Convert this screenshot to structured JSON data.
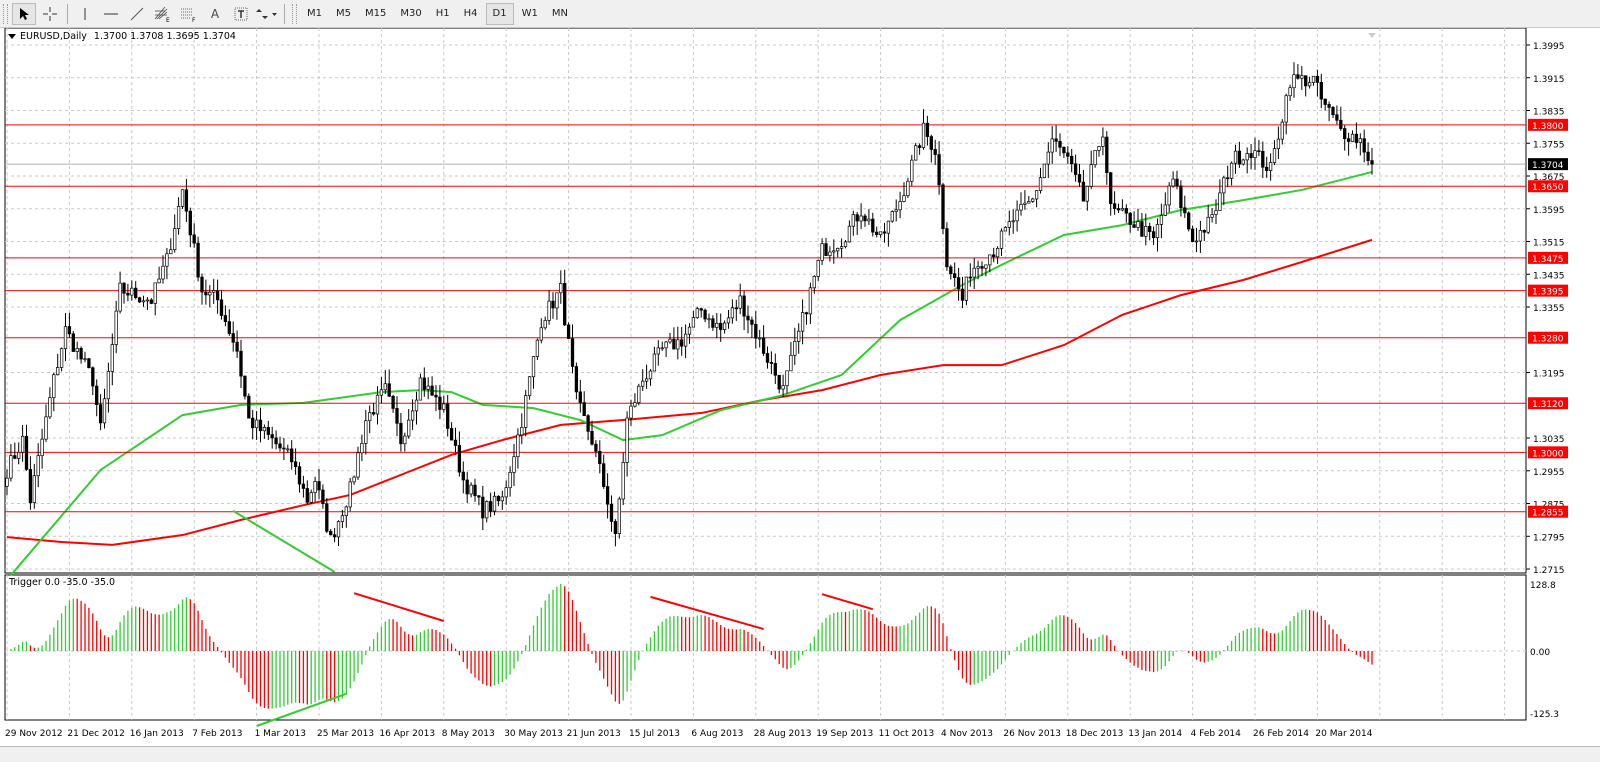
{
  "toolbar": {
    "tools": [
      "cursor-icon",
      "crosshair-icon",
      "vertical-line-icon",
      "horizontal-line-icon",
      "trendline-icon",
      "fibonacci-fan-icon",
      "fibonacci-retracement-icon",
      "text-icon",
      "text-label-icon",
      "arrows-icon"
    ],
    "text_tool": "A",
    "timeframes": [
      "M1",
      "M5",
      "M15",
      "M30",
      "H1",
      "H4",
      "D1",
      "W1",
      "MN"
    ],
    "active_timeframe": "D1"
  },
  "chart_header": {
    "symbol": "EURUSD,Daily",
    "ohlc": "1.3700 1.3708 1.3695 1.3704"
  },
  "indicator_header": "Trigger 0.0 -35.0 -35.0",
  "chart_data": {
    "type": "candlestick",
    "symbol": "EURUSD",
    "timeframe": "Daily",
    "last": {
      "open": 1.37,
      "high": 1.3708,
      "low": 1.3695,
      "close": 1.3704
    },
    "current_price_label": "1.3704",
    "ylim": [
      1.2695,
      1.403
    ],
    "y_ticks": [
      "1.3995",
      "1.3915",
      "1.3835",
      "1.3755",
      "1.3675",
      "1.3595",
      "1.3515",
      "1.3435",
      "1.3355",
      "1.3195",
      "1.3035",
      "1.2955",
      "1.2875",
      "1.2795",
      "1.2715"
    ],
    "levels": [
      {
        "label": "1.3800",
        "value": 1.38
      },
      {
        "label": "1.3650",
        "value": 1.365
      },
      {
        "label": "1.3475",
        "value": 1.3475
      },
      {
        "label": "1.3395",
        "value": 1.3395
      },
      {
        "label": "1.3280",
        "value": 1.328
      },
      {
        "label": "1.3120",
        "value": 1.312
      },
      {
        "label": "1.3000",
        "value": 1.3
      },
      {
        "label": "1.2855",
        "value": 1.2855
      }
    ],
    "level_color": "#ff0000",
    "x_labels": [
      "29 Nov 2012",
      "21 Dec 2012",
      "16 Jan 2013",
      "7 Feb 2013",
      "1 Mar 2013",
      "25 Mar 2013",
      "16 Apr 2013",
      "8 May 2013",
      "30 May 2013",
      "21 Jun 2013",
      "15 Jul 2013",
      "6 Aug 2013",
      "28 Aug 2013",
      "19 Sep 2013",
      "11 Oct 2013",
      "4 Nov 2013",
      "26 Nov 2013",
      "18 Dec 2013",
      "13 Jan 2014",
      "4 Feb 2014",
      "26 Feb 2014",
      "20 Mar 2014"
    ],
    "bars_per_label": 16,
    "bar_count": 351,
    "close_path": [
      [
        0,
        1.2957
      ],
      [
        4,
        1.303
      ],
      [
        6,
        1.2884
      ],
      [
        12,
        1.3177
      ],
      [
        15,
        1.3299
      ],
      [
        22,
        1.3177
      ],
      [
        24,
        1.3055
      ],
      [
        29,
        1.3397
      ],
      [
        37,
        1.3372
      ],
      [
        41,
        1.347
      ],
      [
        45,
        1.3641
      ],
      [
        50,
        1.3397
      ],
      [
        54,
        1.3372
      ],
      [
        59,
        1.325
      ],
      [
        62,
        1.3079
      ],
      [
        68,
        1.303
      ],
      [
        73,
        1.2981
      ],
      [
        77,
        1.2884
      ],
      [
        79,
        1.2933
      ],
      [
        83,
        1.2786
      ],
      [
        88,
        1.2908
      ],
      [
        92,
        1.3079
      ],
      [
        97,
        1.3152
      ],
      [
        101,
        1.303
      ],
      [
        106,
        1.3177
      ],
      [
        112,
        1.3103
      ],
      [
        117,
        1.2933
      ],
      [
        122,
        1.2859
      ],
      [
        127,
        1.2884
      ],
      [
        132,
        1.3079
      ],
      [
        137,
        1.3323
      ],
      [
        142,
        1.3397
      ],
      [
        146,
        1.3128
      ],
      [
        150,
        1.303
      ],
      [
        154,
        1.2884
      ],
      [
        156,
        1.2786
      ],
      [
        159,
        1.3079
      ],
      [
        163,
        1.3177
      ],
      [
        168,
        1.325
      ],
      [
        173,
        1.3274
      ],
      [
        178,
        1.3348
      ],
      [
        183,
        1.3299
      ],
      [
        188,
        1.3372
      ],
      [
        194,
        1.325
      ],
      [
        199,
        1.3152
      ],
      [
        204,
        1.3323
      ],
      [
        209,
        1.3494
      ],
      [
        214,
        1.3519
      ],
      [
        219,
        1.3592
      ],
      [
        224,
        1.3519
      ],
      [
        229,
        1.3616
      ],
      [
        235,
        1.3787
      ],
      [
        238,
        1.3739
      ],
      [
        241,
        1.347
      ],
      [
        245,
        1.3372
      ],
      [
        247,
        1.3445
      ],
      [
        253,
        1.3494
      ],
      [
        258,
        1.3568
      ],
      [
        263,
        1.3616
      ],
      [
        268,
        1.3763
      ],
      [
        272,
        1.3714
      ],
      [
        276,
        1.3616
      ],
      [
        281,
        1.3787
      ],
      [
        283,
        1.3592
      ],
      [
        288,
        1.3568
      ],
      [
        294,
        1.3519
      ],
      [
        299,
        1.3665
      ],
      [
        304,
        1.3519
      ],
      [
        309,
        1.3568
      ],
      [
        314,
        1.3714
      ],
      [
        319,
        1.3739
      ],
      [
        324,
        1.369
      ],
      [
        329,
        1.391
      ],
      [
        335,
        1.391
      ],
      [
        337,
        1.3861
      ],
      [
        342,
        1.3787
      ],
      [
        347,
        1.3763
      ],
      [
        350,
        1.3704
      ]
    ],
    "ma_fast": {
      "color": "#32cd32",
      "points": [
        [
          1,
          1.27
        ],
        [
          24,
          1.2957
        ],
        [
          45,
          1.3091
        ],
        [
          60,
          1.3116
        ],
        [
          76,
          1.3121
        ],
        [
          96,
          1.3147
        ],
        [
          106,
          1.3152
        ],
        [
          114,
          1.3147
        ],
        [
          122,
          1.3116
        ],
        [
          135,
          1.3108
        ],
        [
          147,
          1.3079
        ],
        [
          158,
          1.303
        ],
        [
          168,
          1.3042
        ],
        [
          183,
          1.3103
        ],
        [
          199,
          1.314
        ],
        [
          214,
          1.3189
        ],
        [
          229,
          1.3323
        ],
        [
          245,
          1.3409
        ],
        [
          255,
          1.3458
        ],
        [
          271,
          1.3531
        ],
        [
          286,
          1.3555
        ],
        [
          301,
          1.3592
        ],
        [
          317,
          1.3616
        ],
        [
          332,
          1.3641
        ],
        [
          350,
          1.3685
        ]
      ]
    },
    "ma_slow": {
      "color": "#ff0000",
      "points": [
        [
          0,
          1.2793
        ],
        [
          14,
          1.2781
        ],
        [
          27,
          1.2774
        ],
        [
          45,
          1.2798
        ],
        [
          60,
          1.2835
        ],
        [
          76,
          1.2871
        ],
        [
          88,
          1.2896
        ],
        [
          101,
          1.2945
        ],
        [
          114,
          1.2994
        ],
        [
          127,
          1.303
        ],
        [
          142,
          1.3067
        ],
        [
          158,
          1.3079
        ],
        [
          178,
          1.3096
        ],
        [
          194,
          1.3128
        ],
        [
          209,
          1.3152
        ],
        [
          224,
          1.3189
        ],
        [
          240,
          1.3213
        ],
        [
          255,
          1.3213
        ],
        [
          271,
          1.3262
        ],
        [
          286,
          1.3336
        ],
        [
          301,
          1.3384
        ],
        [
          317,
          1.3421
        ],
        [
          332,
          1.3465
        ],
        [
          350,
          1.3519
        ]
      ]
    },
    "main_trendlines": [
      {
        "color": "#32cd32",
        "from": [
          58,
          1.2857
        ],
        "to": [
          84,
          1.2708
        ]
      }
    ],
    "indicator": {
      "name": "Trigger",
      "ylim": [
        -125.3,
        128.8
      ],
      "y_ticks": [
        "128.8",
        "0.00",
        "-125.3"
      ],
      "up_color": "#32cd32",
      "down_color": "#ff0000",
      "trendlines": [
        {
          "color": "#ff0000",
          "from": [
            89,
            108
          ],
          "to": [
            112,
            56
          ]
        },
        {
          "color": "#ff0000",
          "from": [
            165,
            101
          ],
          "to": [
            194,
            41
          ]
        },
        {
          "color": "#ff0000",
          "from": [
            209,
            106
          ],
          "to": [
            222,
            78
          ]
        },
        {
          "color": "#32cd32",
          "from": [
            64,
            -140
          ],
          "to": [
            87,
            -80
          ]
        }
      ]
    }
  }
}
